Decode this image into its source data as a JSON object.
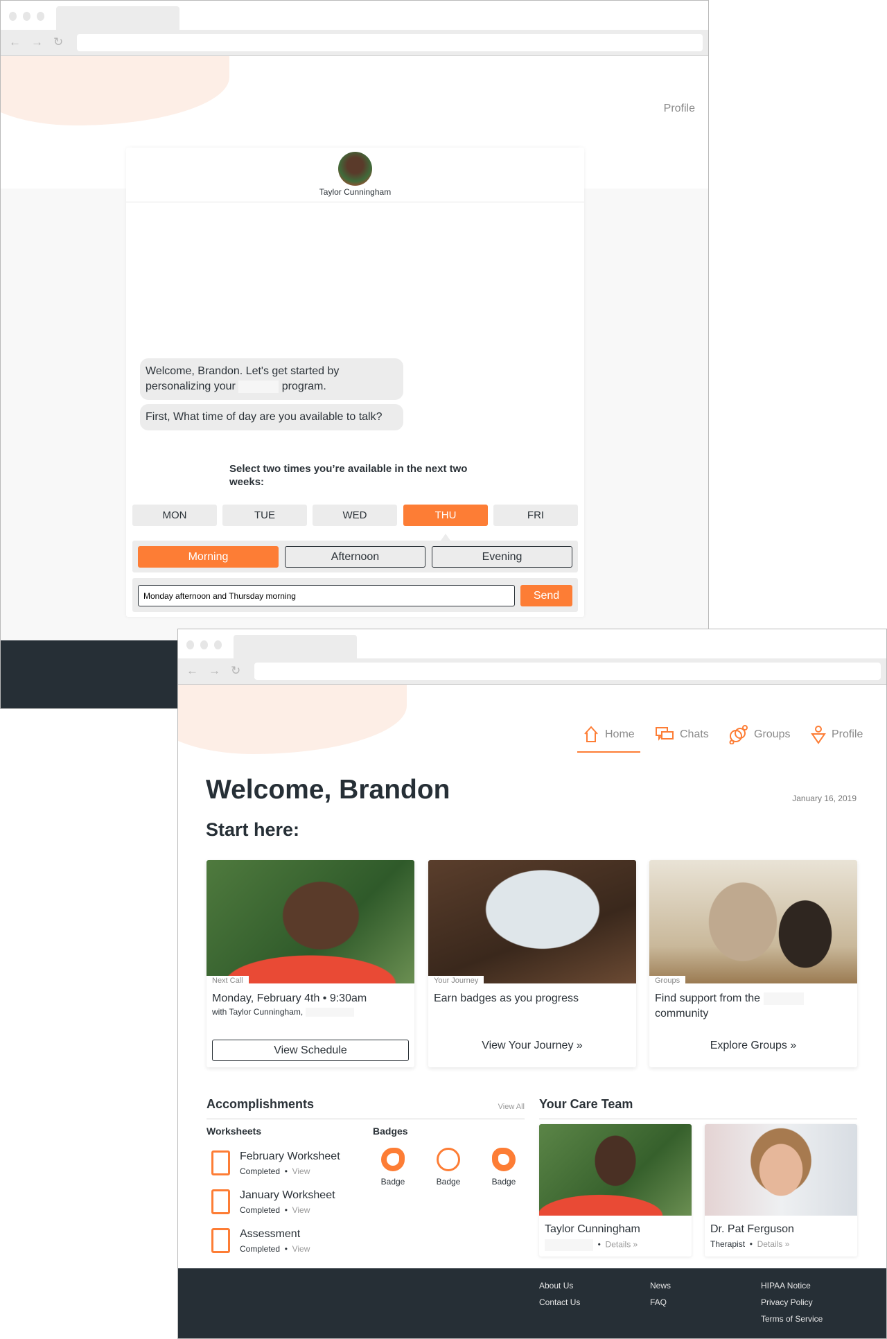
{
  "colors": {
    "accent": "#fd7d35",
    "dark": "#262f36"
  },
  "window1": {
    "nav_profile": "Profile",
    "chat": {
      "agent_name": "Taylor Cunningham",
      "messages": [
        {
          "before": "Welcome, Brandon. Let's get started by personalizing your",
          "after": "program."
        },
        {
          "text": "First, What time of day are you available to talk?"
        }
      ],
      "instruction": "Select two times you’re available in the next two weeks:",
      "days": [
        {
          "label": "MON",
          "selected": false
        },
        {
          "label": "TUE",
          "selected": false
        },
        {
          "label": "WED",
          "selected": false
        },
        {
          "label": "THU",
          "selected": true
        },
        {
          "label": "FRI",
          "selected": false
        }
      ],
      "times": [
        {
          "label": "Morning",
          "selected": true
        },
        {
          "label": "Afternoon",
          "selected": false
        },
        {
          "label": "Evening",
          "selected": false
        }
      ],
      "input_value": "Monday afternoon and Thursday morning",
      "send_label": "Send"
    }
  },
  "window2": {
    "nav": [
      {
        "label": "Home",
        "icon": "home-icon",
        "active": true
      },
      {
        "label": "Chats",
        "icon": "chat-icon"
      },
      {
        "label": "Groups",
        "icon": "groups-icon"
      },
      {
        "label": "Profile",
        "icon": "profile-icon"
      }
    ],
    "welcome": "Welcome, Brandon",
    "date": "January 16, 2019",
    "start_here": "Start here:",
    "cards": [
      {
        "tag": "Next Call",
        "title": "Monday, February 4th • 9:30am",
        "subtitle": "with Taylor Cunningham,",
        "action": "View Schedule"
      },
      {
        "tag": "Your Journey",
        "title": "Earn badges as you progress",
        "action": "View Your Journey »"
      },
      {
        "tag": "Groups",
        "title": "Find support from the",
        "title2": "community",
        "action": "Explore Groups »"
      }
    ],
    "accomplishments": {
      "title": "Accomplishments",
      "view_all": "View All",
      "worksheets_title": "Worksheets",
      "worksheets": [
        {
          "title": "February Worksheet",
          "status": "Completed",
          "link": "View"
        },
        {
          "title": "January Worksheet",
          "status": "Completed",
          "link": "View"
        },
        {
          "title": "Assessment",
          "status": "Completed",
          "link": "View"
        }
      ],
      "badges_title": "Badges",
      "badges": [
        {
          "label": "Badge"
        },
        {
          "label": "Badge"
        },
        {
          "label": "Badge"
        }
      ]
    },
    "care_team": {
      "title": "Your Care Team",
      "members": [
        {
          "name": "Taylor Cunningham",
          "role": "",
          "link": "Details »"
        },
        {
          "name": "Dr. Pat Ferguson",
          "role": "Therapist",
          "link": "Details »"
        }
      ]
    },
    "footer": {
      "col1": [
        "About Us",
        "Contact Us"
      ],
      "col2": [
        "News",
        "FAQ"
      ],
      "col3": [
        "HIPAA Notice",
        "Privacy Policy",
        "Terms of Service"
      ]
    }
  }
}
